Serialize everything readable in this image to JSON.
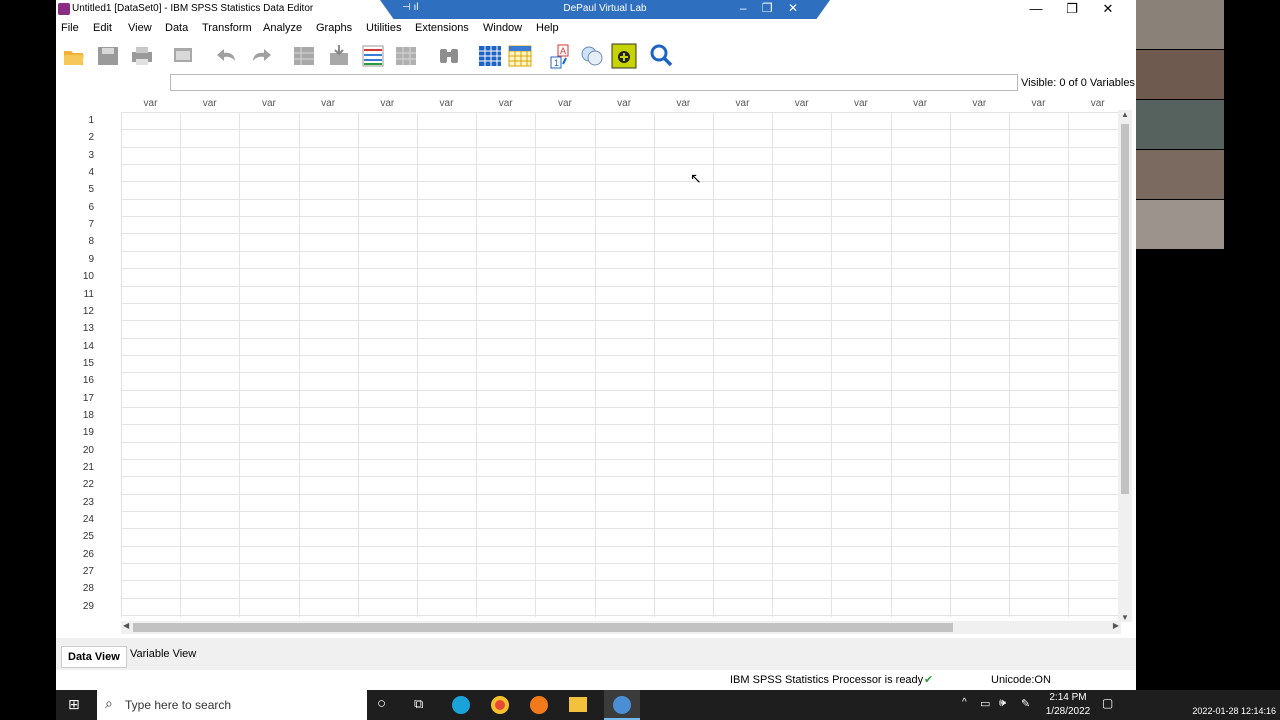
{
  "window": {
    "title": "Untitled1 [DataSet0] - IBM SPSS Statistics Data Editor",
    "remote_session_label": "DePaul Virtual Lab"
  },
  "menu": [
    "File",
    "Edit",
    "View",
    "Data",
    "Transform",
    "Analyze",
    "Graphs",
    "Utilities",
    "Extensions",
    "Window",
    "Help"
  ],
  "toolbar": {
    "icons": [
      "open-folder-icon",
      "save-icon",
      "print-icon",
      "recall-dialog-icon",
      "undo-icon",
      "redo-icon",
      "goto-case-icon",
      "goto-variable-icon",
      "variables-icon",
      "run-descriptives-icon",
      "find-icon",
      "insert-cases-icon",
      "insert-variable-icon",
      "value-labels-icon",
      "use-sets-icon",
      "show-all-variables-icon",
      "search-icon"
    ]
  },
  "cell_editor": {
    "value": ""
  },
  "visible_label": "Visible: 0 of 0 Variables",
  "grid": {
    "column_label": "var",
    "column_count": 17,
    "rows": [
      "1",
      "2",
      "3",
      "4",
      "5",
      "6",
      "7",
      "8",
      "9",
      "10",
      "11",
      "12",
      "13",
      "14",
      "15",
      "16",
      "17",
      "18",
      "19",
      "20",
      "21",
      "22",
      "23",
      "24",
      "25",
      "26",
      "27",
      "28",
      "29"
    ]
  },
  "tabs": {
    "data_view": "Data View",
    "variable_view": "Variable View"
  },
  "status": {
    "processor": "IBM SPSS Statistics Processor is ready",
    "unicode": "Unicode:ON"
  },
  "taskbar": {
    "search_placeholder": "Type here to search",
    "time": "2:14 PM",
    "date": "1/28/2022",
    "recording_timestamp": "2022-01-28 12:14:16"
  },
  "colors": {
    "rdp_bar": "#2f6fc0",
    "grid_line": "#e3e3e3",
    "taskbar": "#1e1e1e",
    "brand": "#8b2d82"
  }
}
